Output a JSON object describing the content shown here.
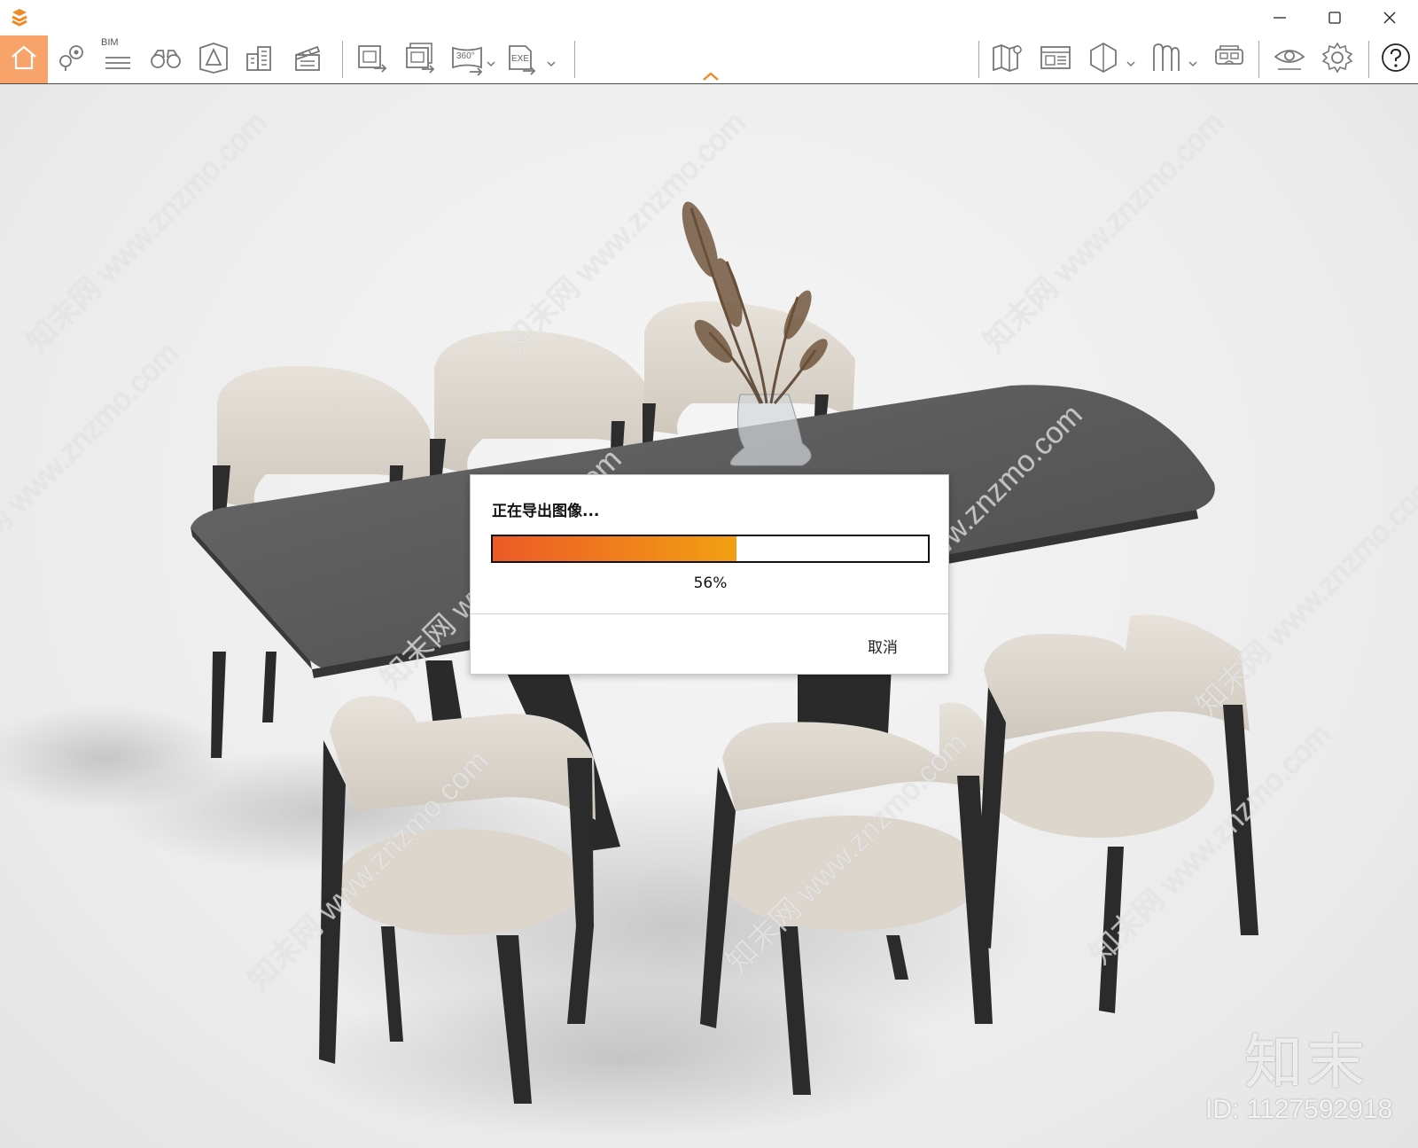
{
  "toolbar": {
    "bim_label": "BIM",
    "buttons": [
      "home-icon",
      "location-pin-icon",
      "bim-list-icon",
      "binoculars-icon",
      "camera-view-icon",
      "buildings-icon",
      "clapperboard-icon",
      "export-image-icon",
      "export-image-batch-icon",
      "export-360-icon",
      "export-exe-icon",
      "map-icon",
      "panel-icon",
      "section-box-icon",
      "material-icon",
      "vr-headset-icon",
      "visibility-icon",
      "settings-icon",
      "help-icon"
    ],
    "label_360": "360°",
    "label_exe": "EXE",
    "accent_color": "#f7a36a"
  },
  "dialog": {
    "title": "正在导出图像...",
    "progress": 0.56,
    "progress_text": "56%",
    "cancel_label": "取消"
  },
  "watermark": {
    "text": "知末网 www.znzmo.com",
    "brand": "知末",
    "id_text": "ID: 1127592918"
  }
}
